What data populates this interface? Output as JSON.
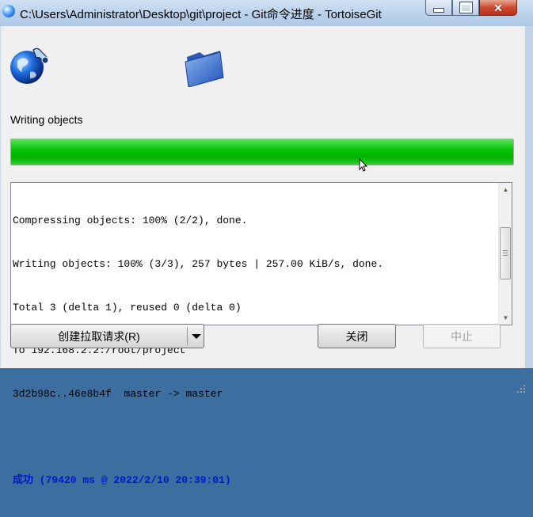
{
  "window": {
    "title": "C:\\Users\\Administrator\\Desktop\\git\\project - Git命令进度 - TortoiseGit"
  },
  "status": {
    "label": "Writing objects",
    "progress_fraction": 1.0
  },
  "log": {
    "lines": [
      "Compressing objects: 100% (2/2), done.",
      "Writing objects: 100% (3/3), 257 bytes | 257.00 KiB/s, done.",
      "Total 3 (delta 1), reused 0 (delta 0)",
      "To 192.168.2.2:/root/project",
      "3d2b98c..46e8b4f  master -> master",
      "",
      "成功 (79420 ms @ 2022/2/10 20:39:01)"
    ]
  },
  "buttons": {
    "pull_request": "创建拉取请求(R)",
    "close": "关闭",
    "abort": "中止"
  },
  "colors": {
    "progress_green": "#00c000",
    "success_text": "#0018c8"
  },
  "icons": [
    "globe-icon",
    "folder-icon",
    "minimize-icon",
    "maximize-icon",
    "close-icon",
    "dropdown-arrow-icon"
  ]
}
